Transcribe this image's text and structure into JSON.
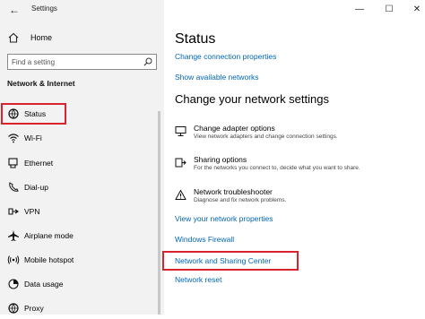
{
  "window": {
    "title": "Settings"
  },
  "sidebar": {
    "home_label": "Home",
    "search_placeholder": "Find a setting",
    "section_title": "Network & Internet",
    "items": [
      {
        "label": "Status",
        "icon": "globe-icon",
        "active": true
      },
      {
        "label": "Wi-Fi",
        "icon": "wifi-icon"
      },
      {
        "label": "Ethernet",
        "icon": "ethernet-icon"
      },
      {
        "label": "Dial-up",
        "icon": "dialup-icon"
      },
      {
        "label": "VPN",
        "icon": "vpn-icon"
      },
      {
        "label": "Airplane mode",
        "icon": "airplane-icon"
      },
      {
        "label": "Mobile hotspot",
        "icon": "hotspot-icon"
      },
      {
        "label": "Data usage",
        "icon": "data-usage-icon"
      },
      {
        "label": "Proxy",
        "icon": "globe-icon"
      }
    ]
  },
  "main": {
    "title": "Status",
    "links_top": [
      "Change connection properties",
      "Show available networks"
    ],
    "subtitle": "Change your network settings",
    "options": [
      {
        "title": "Change adapter options",
        "desc": "View network adapters and change connection settings.",
        "icon": "adapter-icon"
      },
      {
        "title": "Sharing options",
        "desc": "For the networks you connect to, decide what you want to share.",
        "icon": "sharing-icon"
      },
      {
        "title": "Network troubleshooter",
        "desc": "Diagnose and fix network problems.",
        "icon": "warning-icon"
      }
    ],
    "links_bottom": [
      "View your network properties",
      "Windows Firewall",
      "Network and Sharing Center",
      "Network reset"
    ]
  },
  "colors": {
    "link": "#0066b4",
    "highlight": "#d9232d",
    "accent": "#0078d7",
    "sidebar_bg": "#f2f2f2"
  }
}
